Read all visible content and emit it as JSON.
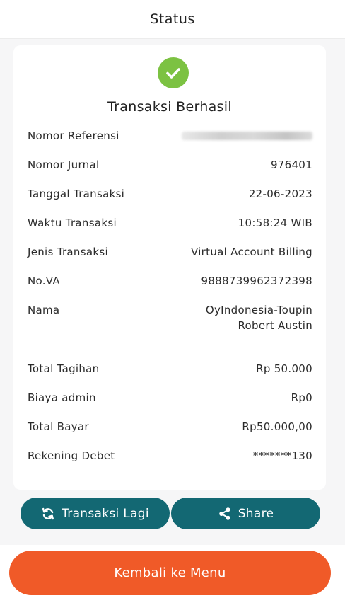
{
  "header": {
    "title": "Status"
  },
  "receipt": {
    "title": "Transaksi Berhasil",
    "rows": [
      {
        "label": "Nomor Referensi",
        "value": ""
      },
      {
        "label": "Nomor Jurnal",
        "value": "976401"
      },
      {
        "label": "Tanggal Transaksi",
        "value": "22-06-2023"
      },
      {
        "label": "Waktu Transaksi",
        "value": "10:58:24 WIB"
      },
      {
        "label": "Jenis Transaksi",
        "value": "Virtual Account Billing"
      },
      {
        "label": "No.VA",
        "value": "9888739962372398"
      },
      {
        "label": "Nama",
        "value_line1": "OyIndonesia-Toupin",
        "value_line2": "Robert Austin"
      }
    ],
    "totals": [
      {
        "label": "Total Tagihan",
        "value": "Rp 50.000"
      },
      {
        "label": "Biaya admin",
        "value": "Rp0"
      },
      {
        "label": "Total Bayar",
        "value": "Rp50.000,00"
      },
      {
        "label": "Rekening Debet",
        "value": "*******130"
      }
    ]
  },
  "actions": {
    "again_label": "Transaksi Lagi",
    "share_label": "Share",
    "back_label": "Kembali ke Menu"
  },
  "icons": {
    "success": "check-circle-icon",
    "again": "refresh-icon",
    "share": "share-icon"
  },
  "colors": {
    "success": "#7cc242",
    "primary": "#136873",
    "accent": "#f05a28"
  }
}
